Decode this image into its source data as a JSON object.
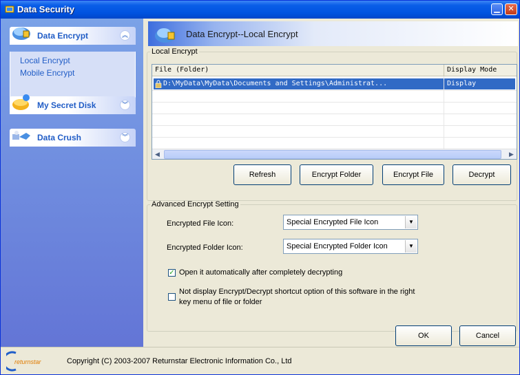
{
  "window": {
    "title": "Data Security"
  },
  "sidebar": {
    "groups": [
      {
        "title": "Data Encrypt",
        "expanded": true,
        "items": [
          "Local Encrypt",
          "Mobile Encrypt"
        ]
      },
      {
        "title": "My Secret Disk",
        "expanded": false
      },
      {
        "title": "Data Crush",
        "expanded": false
      }
    ]
  },
  "header": {
    "title": "Data Encrypt--Local Encrypt"
  },
  "local_encrypt": {
    "legend": "Local Encrypt",
    "columns": [
      "File (Folder)",
      "Display Mode"
    ],
    "rows": [
      {
        "file": "D:\\MyData\\MyData\\Documents and Settings\\Administrat...",
        "mode": "Display"
      }
    ],
    "buttons": {
      "refresh": "Refresh",
      "encrypt_folder": "Encrypt Folder",
      "encrypt_file": "Encrypt File",
      "decrypt": "Decrypt"
    }
  },
  "advanced": {
    "legend": "Advanced Encrypt Setting",
    "file_icon_label": "Encrypted File Icon:",
    "file_icon_value": "Special Encrypted File Icon",
    "folder_icon_label": "Encrypted Folder Icon:",
    "folder_icon_value": "Special Encrypted Folder Icon",
    "open_auto_label": "Open it automatically after completely decrypting",
    "open_auto_checked": true,
    "no_shortcut_label_line1": "Not display Encrypt/Decrypt shortcut option of this software in the right",
    "no_shortcut_label_line2": "key menu of file or folder",
    "no_shortcut_checked": false
  },
  "dialog_buttons": {
    "ok": "OK",
    "cancel": "Cancel"
  },
  "footer": {
    "copyright": "Copyright (C) 2003-2007 Returnstar Electronic Information Co., Ltd",
    "logo_text": "returnstar"
  },
  "colors": {
    "titlebar": "#0052e0",
    "sidebar": "#6f8ddf",
    "selection": "#316ac5",
    "link": "#215dc6"
  },
  "icons": [
    "app-icon",
    "data-encrypt-icon",
    "secret-disk-icon",
    "data-crush-icon",
    "lock-icon",
    "collapse-icon",
    "expand-icon",
    "dropdown-arrow-icon"
  ]
}
